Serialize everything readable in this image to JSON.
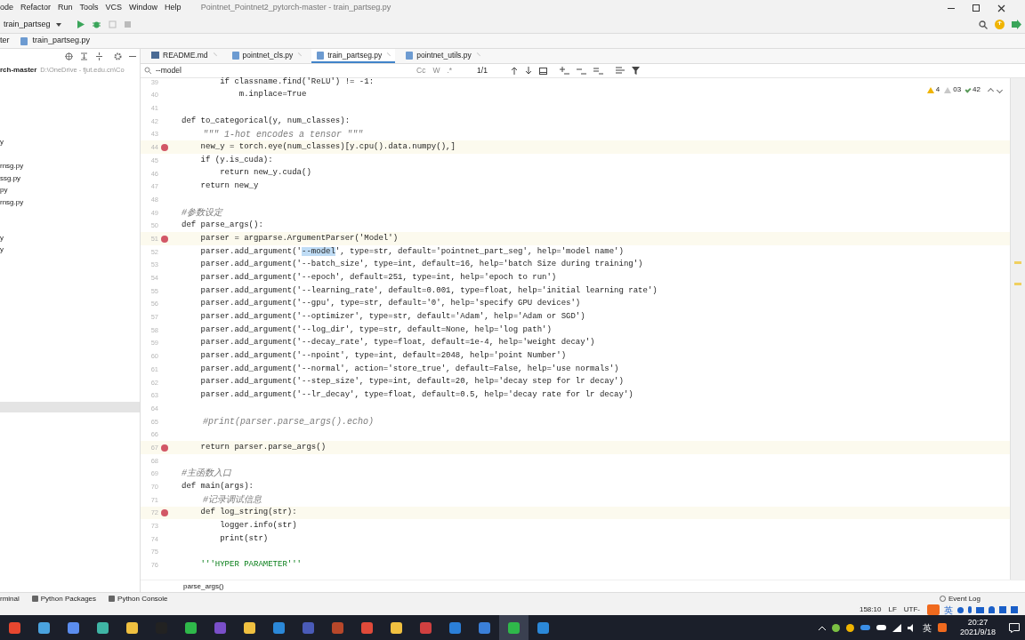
{
  "menu": [
    "ode",
    "Refactor",
    "Run",
    "Tools",
    "VCS",
    "Window",
    "Help"
  ],
  "window": {
    "title": "Pointnet_Pointnet2_pytorch-master - train_partseg.py"
  },
  "toolbar": {
    "run_config": "train_partseg"
  },
  "breadcrumb": [
    "ter",
    "train_partseg.py"
  ],
  "project_tree": {
    "root": "rch-master",
    "root_path": "D:\\OneDrive - fjut.edu.cn\\Co",
    "groups": [
      [
        "y"
      ],
      [
        "rnsg.py",
        "ssg.py",
        "py",
        "rnsg.py"
      ],
      [
        "y",
        "y"
      ]
    ]
  },
  "tabs": [
    {
      "label": "README.md",
      "kind": "markdown",
      "selected": false
    },
    {
      "label": "pointnet_cls.py",
      "kind": "python",
      "selected": false
    },
    {
      "label": "train_partseg.py",
      "kind": "python",
      "selected": true
    },
    {
      "label": "pointnet_utils.py",
      "kind": "python",
      "selected": false
    }
  ],
  "search": {
    "value": "--model",
    "options": [
      "Cc",
      "W",
      ".*"
    ],
    "matches": "1/1"
  },
  "inspections": [
    {
      "kind": "warning",
      "count": "4"
    },
    {
      "kind": "weak",
      "count": "03"
    },
    {
      "kind": "ok",
      "count": "42"
    }
  ],
  "lines": [
    {
      "num": "39",
      "kind": "code",
      "breakpoint": false,
      "text": "        if classname.find('ReLU') != -1:"
    },
    {
      "num": "40",
      "kind": "code",
      "breakpoint": false,
      "text": "            m.inplace=True"
    },
    {
      "num": "41",
      "kind": "blank",
      "breakpoint": false
    },
    {
      "num": "42",
      "kind": "code",
      "breakpoint": false,
      "text": "def to_categorical(y, num_classes):"
    },
    {
      "num": "43",
      "kind": "comment",
      "breakpoint": false,
      "text": "    \"\"\" 1-hot encodes a tensor \"\"\""
    },
    {
      "num": "44",
      "kind": "code",
      "breakpoint": true,
      "text": "    new_y = torch.eye(num_classes)[y.cpu().data.numpy(),]"
    },
    {
      "num": "45",
      "kind": "code",
      "breakpoint": false,
      "text": "    if (y.is_cuda):"
    },
    {
      "num": "46",
      "kind": "code",
      "breakpoint": false,
      "text": "        return new_y.cuda()"
    },
    {
      "num": "47",
      "kind": "code",
      "breakpoint": false,
      "text": "    return new_y"
    },
    {
      "num": "48",
      "kind": "blank",
      "breakpoint": false
    },
    {
      "num": "49",
      "kind": "comment",
      "breakpoint": false,
      "text": "#参数设定"
    },
    {
      "num": "50",
      "kind": "code",
      "breakpoint": false,
      "text": "def parse_args():"
    },
    {
      "num": "51",
      "kind": "code",
      "breakpoint": true,
      "text": "    parser = argparse.ArgumentParser('Model')"
    },
    {
      "num": "52",
      "kind": "code",
      "breakpoint": false,
      "text": "    parser.add_argument('",
      "match": "--model",
      "after": "', type=str, default='pointnet_part_seg', help='model name')"
    },
    {
      "num": "53",
      "kind": "code",
      "breakpoint": false,
      "text": "    parser.add_argument('--batch_size', type=int, default=16, help='batch Size during training')"
    },
    {
      "num": "54",
      "kind": "code",
      "breakpoint": false,
      "text": "    parser.add_argument('--epoch', default=251, type=int, help='epoch to run')"
    },
    {
      "num": "55",
      "kind": "code",
      "breakpoint": false,
      "text": "    parser.add_argument('--learning_rate', default=0.001, type=float, help='initial learning rate')"
    },
    {
      "num": "56",
      "kind": "code",
      "breakpoint": false,
      "text": "    parser.add_argument('--gpu', type=str, default='0', help='specify GPU devices')"
    },
    {
      "num": "57",
      "kind": "code",
      "breakpoint": false,
      "text": "    parser.add_argument('--optimizer', type=str, default='Adam', help='Adam or SGD')"
    },
    {
      "num": "58",
      "kind": "code",
      "breakpoint": false,
      "text": "    parser.add_argument('--log_dir', type=str, default=None, help='log path')"
    },
    {
      "num": "59",
      "kind": "code",
      "breakpoint": false,
      "text": "    parser.add_argument('--decay_rate', type=float, default=1e-4, help='weight decay')"
    },
    {
      "num": "60",
      "kind": "code",
      "breakpoint": false,
      "text": "    parser.add_argument('--npoint', type=int, default=2048, help='point Number')"
    },
    {
      "num": "61",
      "kind": "code",
      "breakpoint": false,
      "text": "    parser.add_argument('--normal', action='store_true', default=False, help='use normals')"
    },
    {
      "num": "62",
      "kind": "code",
      "breakpoint": false,
      "text": "    parser.add_argument('--step_size', type=int, default=20, help='decay step for lr decay')"
    },
    {
      "num": "63",
      "kind": "code",
      "breakpoint": false,
      "text": "    parser.add_argument('--lr_decay', type=float, default=0.5, help='decay rate for lr decay')"
    },
    {
      "num": "64",
      "kind": "blank",
      "breakpoint": false
    },
    {
      "num": "65",
      "kind": "comment",
      "breakpoint": false,
      "text": "    #print(parser.parse_args().echo)"
    },
    {
      "num": "66",
      "kind": "blank",
      "breakpoint": false
    },
    {
      "num": "67",
      "kind": "code",
      "breakpoint": true,
      "text": "    return parser.parse_args()"
    },
    {
      "num": "68",
      "kind": "blank",
      "breakpoint": false
    },
    {
      "num": "69",
      "kind": "comment",
      "breakpoint": false,
      "text": "#主函数入口"
    },
    {
      "num": "70",
      "kind": "code",
      "breakpoint": false,
      "text": "def main(args):"
    },
    {
      "num": "71",
      "kind": "comment",
      "breakpoint": false,
      "text": "    #记录调试信息"
    },
    {
      "num": "72",
      "kind": "code",
      "breakpoint": true,
      "text": "    def log_string(str):"
    },
    {
      "num": "73",
      "kind": "code",
      "breakpoint": false,
      "text": "        logger.info(str)"
    },
    {
      "num": "74",
      "kind": "code",
      "breakpoint": false,
      "text": "        print(str)"
    },
    {
      "num": "75",
      "kind": "blank",
      "breakpoint": false
    },
    {
      "num": "76",
      "kind": "string",
      "breakpoint": false,
      "text": "    '''HYPER PARAMETER'''"
    }
  ],
  "editor_breadcrumb": "parse_args()",
  "tool_windows": [
    "rminal",
    "Python Packages",
    "Python Console"
  ],
  "event_log": "Event Log",
  "status_bar": [
    "158:10",
    "LF",
    "UTF-"
  ],
  "ime": "英",
  "tray": {
    "ime": "英",
    "time": "20:27",
    "date": "2021/9/18"
  }
}
